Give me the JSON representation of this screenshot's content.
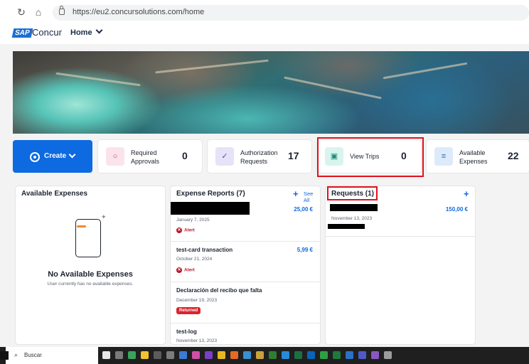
{
  "browser": {
    "url": "https://eu2.concursolutions.com/home"
  },
  "header": {
    "logo_mark": "SAP",
    "logo_text": "Concur",
    "home_menu": "Home"
  },
  "quick_actions": {
    "create_label": "Create",
    "tiles": [
      {
        "label_line1": "Required",
        "label_line2": "Approvals",
        "count": "0",
        "icon": "person-icon",
        "color": "#fbe3ec"
      },
      {
        "label_line1": "Authorization",
        "label_line2": "Requests",
        "count": "17",
        "icon": "check-icon",
        "color": "#e6e3f8"
      },
      {
        "label_line1": "View Trips",
        "label_line2": "",
        "count": "0",
        "icon": "suitcase-icon",
        "color": "#d9f4ef"
      },
      {
        "label_line1": "Available",
        "label_line2": "Expenses",
        "count": "22",
        "icon": "receipt-icon",
        "color": "#ddeafa"
      }
    ]
  },
  "available_expenses": {
    "title": "Available Expenses",
    "empty_heading": "No Available Expenses",
    "empty_sub": "User currently has no available expenses."
  },
  "expense_reports": {
    "title": "Expense Reports (7)",
    "see_all": "See All",
    "items": [
      {
        "name": "",
        "date": "January 7, 2025",
        "amount": "25,00 €",
        "status": "Alert"
      },
      {
        "name": "test-card transaction",
        "date": "October 21, 2024",
        "amount": "5,99 €",
        "status": "Alert"
      },
      {
        "name": "Declaración del recibo que falta",
        "date": "December 19, 2023",
        "amount": "",
        "status": "Returned"
      },
      {
        "name": "test-log",
        "date": "November 13, 2023",
        "amount": "",
        "status": ""
      }
    ]
  },
  "requests": {
    "title": "Requests (1)",
    "items": [
      {
        "name": "",
        "date": "November 13, 2023",
        "amount": "150,00 €"
      }
    ]
  },
  "taskbar": {
    "search_label": "Buscar"
  },
  "colors": {
    "accent": "#0d6ae0",
    "highlight": "#e0121b",
    "alert": "#c0152a",
    "returned": "#d9252e"
  }
}
